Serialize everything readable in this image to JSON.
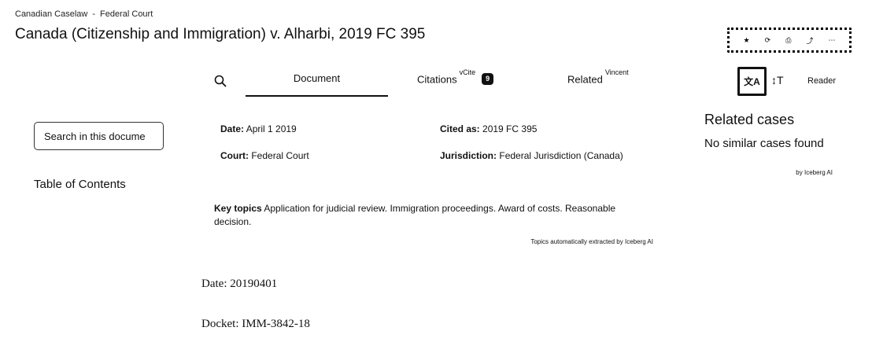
{
  "breadcrumb": {
    "items": [
      "Canadian Caselaw",
      "Federal Court"
    ],
    "separator": "-"
  },
  "page_title": "Canada (Citizenship and Immigration) v. Alharbi, 2019 FC 395",
  "toolbar_icons": [
    "star-icon",
    "refresh-icon",
    "print-icon",
    "share-icon",
    "more-icon"
  ],
  "tabs": {
    "document": "Document",
    "citations": "Citations",
    "citations_sup": "vCite",
    "citations_count": "9",
    "related": "Related",
    "related_sup": "Vincent"
  },
  "tools": {
    "translate_glyph": "文A",
    "textsize_glyph": "↕T",
    "reader": "Reader"
  },
  "sidebar": {
    "search_button": "Search in this docume",
    "toc_heading": "Table of Contents"
  },
  "meta": {
    "date_label": "Date:",
    "date_value": "April 1 2019",
    "cited_label": "Cited as:",
    "cited_value": "2019 FC 395",
    "court_label": "Court:",
    "court_value": "Federal Court",
    "jurisdiction_label": "Jurisdiction:",
    "jurisdiction_value": "Federal Jurisdiction (Canada)"
  },
  "key_topics": {
    "label": "Key topics",
    "text": "Application for judicial review. Immigration proceedings. Award of costs. Reasonable decision.",
    "note": "Topics automatically extracted by Iceberg AI"
  },
  "related": {
    "title": "Related cases",
    "empty": "No similar cases found",
    "credit": "by Iceberg AI"
  },
  "document": {
    "date_line": "Date: 20190401",
    "docket_line": "Docket: IMM-3842-18"
  }
}
